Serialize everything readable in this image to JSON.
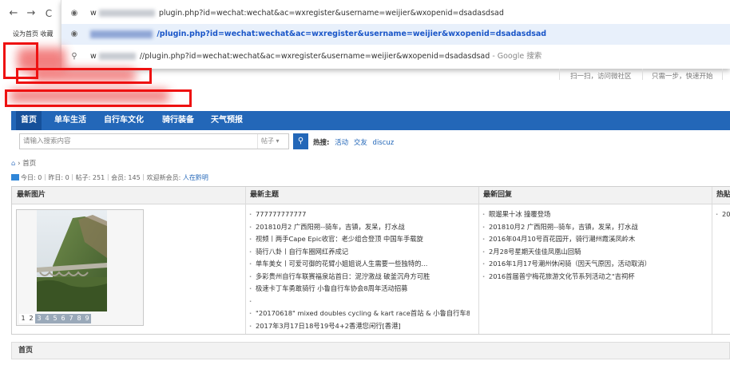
{
  "browser": {
    "back_icon": "arrow-left-icon",
    "forward_icon": "arrow-right-icon",
    "reload_icon": "reload-icon",
    "address_text": "w",
    "bookmarks_bar": "设为首页 收藏"
  },
  "suggestions": [
    {
      "icon": "globe-icon",
      "prefix": "w",
      "text": "plugin.php?id=wechat:wechat&ac=wxregister&username=weijier&wxopenid=dsadasdsad",
      "suffix": ""
    },
    {
      "icon": "globe-icon",
      "prefix": "",
      "text": "/plugin.php?id=wechat:wechat&ac=wxregister&username=weijier&wxopenid=dsadasdsad",
      "suffix": ""
    },
    {
      "icon": "search-icon",
      "prefix": "w",
      "text": "//plugin.php?id=wechat:wechat&ac=wxregister&username=weijier&wxopenid=dsadasdsad",
      "suffix": " - Google 搜索"
    }
  ],
  "header": {
    "scan_link": "扫一扫，访问微社区",
    "quick_start": "只需一步，快速开始"
  },
  "nav": {
    "items": [
      "首页",
      "单车生活",
      "自行车文化",
      "骑行装备",
      "天气预报"
    ],
    "active_index": 0
  },
  "search": {
    "placeholder": "请输入搜索内容",
    "type_label": "帖子",
    "hot_label": "热搜:",
    "hot_terms": [
      "活动",
      "交友",
      "discuz"
    ]
  },
  "breadcrumb": {
    "home_icon": "home-icon",
    "separator": "›",
    "current": "首页"
  },
  "stats": {
    "text": "今日: 0｜昨日: 0｜帖子: 251｜会员: 145｜欢迎新会员: ",
    "new_member": "人在黔明"
  },
  "panel": {
    "columns": [
      "最新图片",
      "最新主题",
      "最新回复",
      "热贴"
    ],
    "pager": [
      "1",
      "2",
      "3",
      "4",
      "5",
      "6",
      "7",
      "8",
      "9"
    ],
    "pager_active": 0,
    "latest_topics": [
      "777777777777",
      "201810月2 广西阳朔--骑车，吉镇，发呆，打水战",
      "视频丨两手Cape Epic收官：老少组合登顶 中国车手载旋",
      "骑行八卦丨自行车圈网红养成记",
      "单车美女丨可爱可御的花臂小姐姐说人生需要一些独特的...",
      "多彩贵州自行车联赛福泉站首日：泥泞激战 破釜沉舟方可胜",
      "极速卡丁车勇敢骑行 小鲁自行车协会8周年活动招募",
      "",
      "\"20170618\" mixed doubles cycling & kart race首站 & 小鲁自行车8周年",
      "2017年3月17日18号19号4+2香港您闲行[香港]"
    ],
    "latest_replies": [
      "眼遛果十冰 撞覆登场",
      "201810月2 广西阳朔--骑车，吉镇，发呆，打水战",
      "2016年04月10号百花园开，骑行潮州霞溪凤岭木",
      "2月28号星期天佳佳凤凰山回騎",
      "2016年1月17号潮州休闲骑（因天气原因，活动取消）",
      "2016首届普宁梅花旅游文化节系列活动之\"吉祠杯"
    ],
    "hot_posts": [
      "20"
    ]
  },
  "footer": {
    "title": "首页"
  },
  "colors": {
    "nav_bg": "#2367b8",
    "nav_active": "#16509a",
    "annotation_red": "#e11111",
    "suggestion_highlight": "#e8f0fb"
  }
}
